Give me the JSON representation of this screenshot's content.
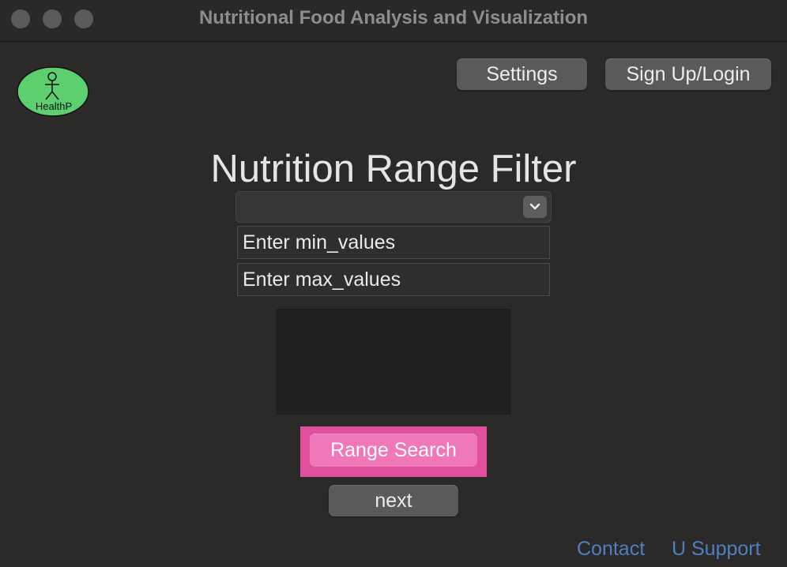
{
  "window": {
    "title": "Nutritional Food Analysis and Visualization"
  },
  "logo": {
    "text": "HealthP",
    "fill_color": "#5dcf6f"
  },
  "header": {
    "settings_label": "Settings",
    "signup_label": "Sign Up/Login"
  },
  "main": {
    "heading": "Nutrition Range Filter",
    "nutrient_select": {
      "selected": ""
    },
    "min_input": {
      "placeholder": "Enter min_values"
    },
    "max_input": {
      "placeholder": "Enter max_values"
    },
    "range_search_label": "Range Search",
    "next_label": "next"
  },
  "footer": {
    "contact_label": "Contact",
    "support_label": "U Support"
  },
  "colors": {
    "background": "#2b2a29",
    "highlight": "#e0509f",
    "range_button": "#f077b8",
    "link": "#4f7fc0"
  }
}
